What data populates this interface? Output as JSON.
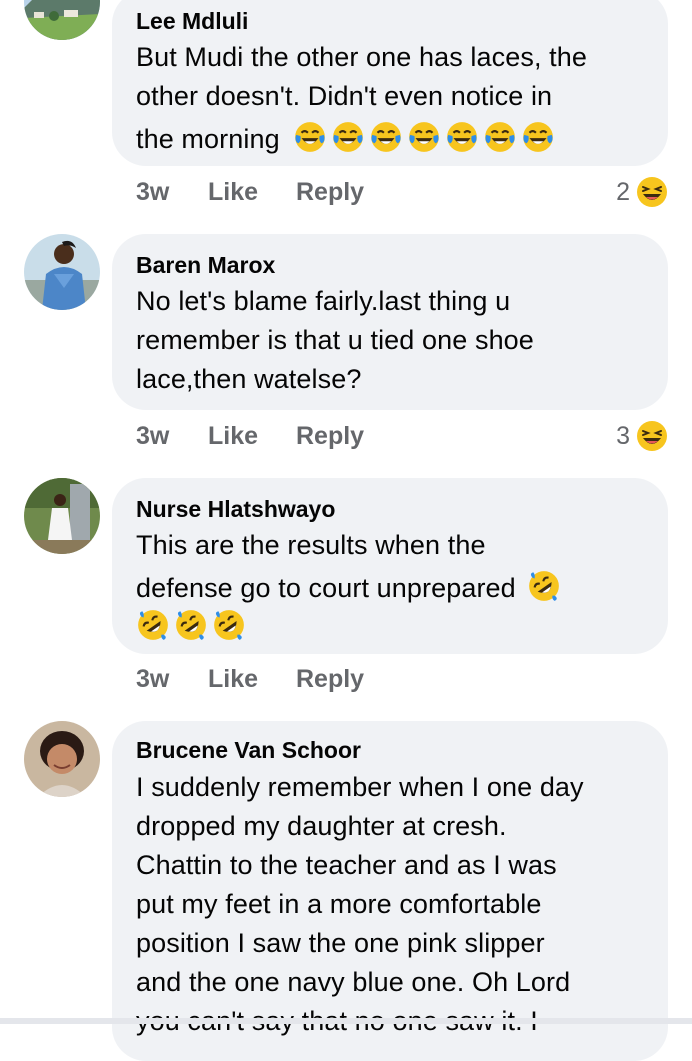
{
  "comments": [
    {
      "author": "Lee Mdluli",
      "lines": [
        "But Mudi the other one has laces, the",
        "other doesn't. Didn't even notice in",
        "the morning"
      ],
      "emoji_count": 7,
      "time": "3w",
      "like": "Like",
      "reply": "Reply",
      "reaction_count": "2",
      "reaction_icon": "laugh-reaction-icon"
    },
    {
      "author": "Baren Marox",
      "lines": [
        "No let's blame fairly.last thing u",
        "remember is that u tied one shoe",
        "lace,then watelse?"
      ],
      "time": "3w",
      "like": "Like",
      "reply": "Reply",
      "reaction_count": "3",
      "reaction_icon": "laugh-reaction-icon"
    },
    {
      "author": "Nurse Hlatshwayo",
      "lines": [
        "This are the results when the",
        "defense go to court unprepared"
      ],
      "emoji_count_line2": 1,
      "emoji_count_line3": 3,
      "time": "3w",
      "like": "Like",
      "reply": "Reply"
    },
    {
      "author": "Brucene Van Schoor",
      "lines": [
        "I suddenly remember when I one day",
        "dropped my daughter at cresh.",
        "Chattin to the teacher and  as I was",
        "put my feet in a more comfortable",
        "position  I saw the one pink slipper",
        "and the one navy blue one. Oh Lord",
        "you can't say that no one saw it. I"
      ]
    }
  ],
  "colors": {
    "bubble": "#f0f2f5",
    "meta": "#65676b",
    "text": "#050505",
    "emoji_yellow": "#f7c51e",
    "tear_blue": "#2f8ee8"
  }
}
